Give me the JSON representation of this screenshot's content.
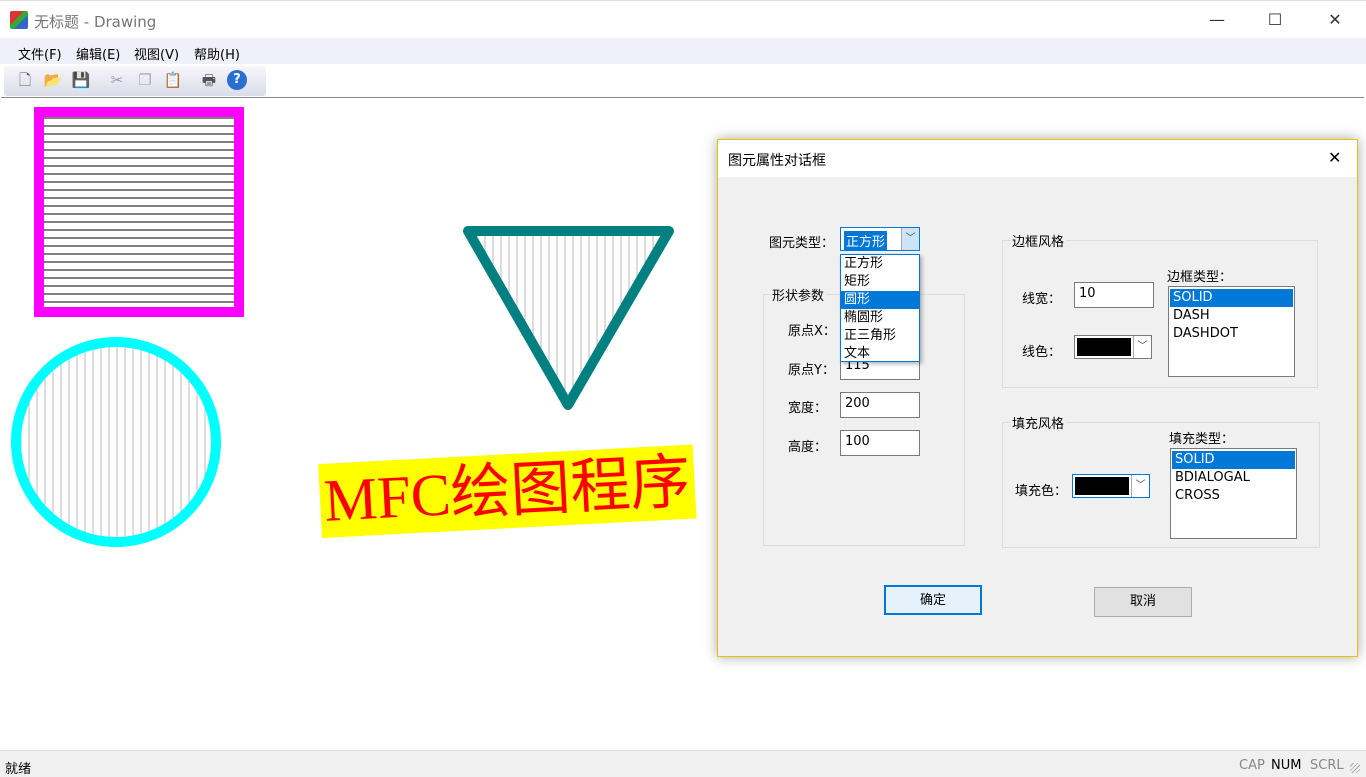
{
  "window": {
    "title": "无标题 - Drawing",
    "minimize": "—",
    "maximize": "☐",
    "close": "✕"
  },
  "menu": [
    {
      "label": "文件(F)"
    },
    {
      "label": "编辑(E)"
    },
    {
      "label": "视图(V)"
    },
    {
      "label": "帮助(H)"
    }
  ],
  "toolbar": [
    {
      "icon": "new-file-icon",
      "glyph": "🗋"
    },
    {
      "icon": "open-folder-icon",
      "glyph": "📂"
    },
    {
      "icon": "save-icon",
      "glyph": "💾"
    },
    {
      "icon": "cut-icon",
      "glyph": "✂"
    },
    {
      "icon": "copy-icon",
      "glyph": "❐"
    },
    {
      "icon": "paste-icon",
      "glyph": "📋"
    },
    {
      "icon": "print-icon",
      "glyph": "🖶"
    },
    {
      "icon": "help-icon",
      "glyph": "?"
    }
  ],
  "canvas": {
    "text": "MFC绘图程序",
    "colors": {
      "square_border": "#ff00ff",
      "circle_border": "#00ffff",
      "triangle_border": "#008080",
      "text_color": "#ff0000",
      "text_bg": "#ffff00"
    }
  },
  "dialog": {
    "title": "图元属性对话框",
    "type_label": "图元类型：",
    "type_value": "正方形",
    "type_options": [
      "正方形",
      "矩形",
      "圆形",
      "椭圆形",
      "正三角形",
      "文本"
    ],
    "type_highlight": "圆形",
    "shape_group": "形状参数",
    "x_label": "原点X：",
    "y_label": "原点Y：",
    "y_value": "115",
    "width_label": "宽度：",
    "width_value": "200",
    "height_label": "高度：",
    "height_value": "100",
    "border_group": "边框风格",
    "line_width_label": "线宽：",
    "line_width_value": "10",
    "line_color_label": "线色：",
    "border_type_label": "边框类型：",
    "border_types": [
      "SOLID",
      "DASH",
      "DASHDOT"
    ],
    "border_type_selected": "SOLID",
    "fill_group": "填充风格",
    "fill_color_label": "填充色：",
    "fill_type_label": "填充类型：",
    "fill_types": [
      "SOLID",
      "BDIALOGAL",
      "CROSS"
    ],
    "fill_type_selected": "SOLID",
    "ok": "确定",
    "cancel": "取消",
    "close": "✕"
  },
  "status": {
    "text": "就绪",
    "cap": "CAP",
    "num": "NUM",
    "scrl": "SCRL"
  }
}
